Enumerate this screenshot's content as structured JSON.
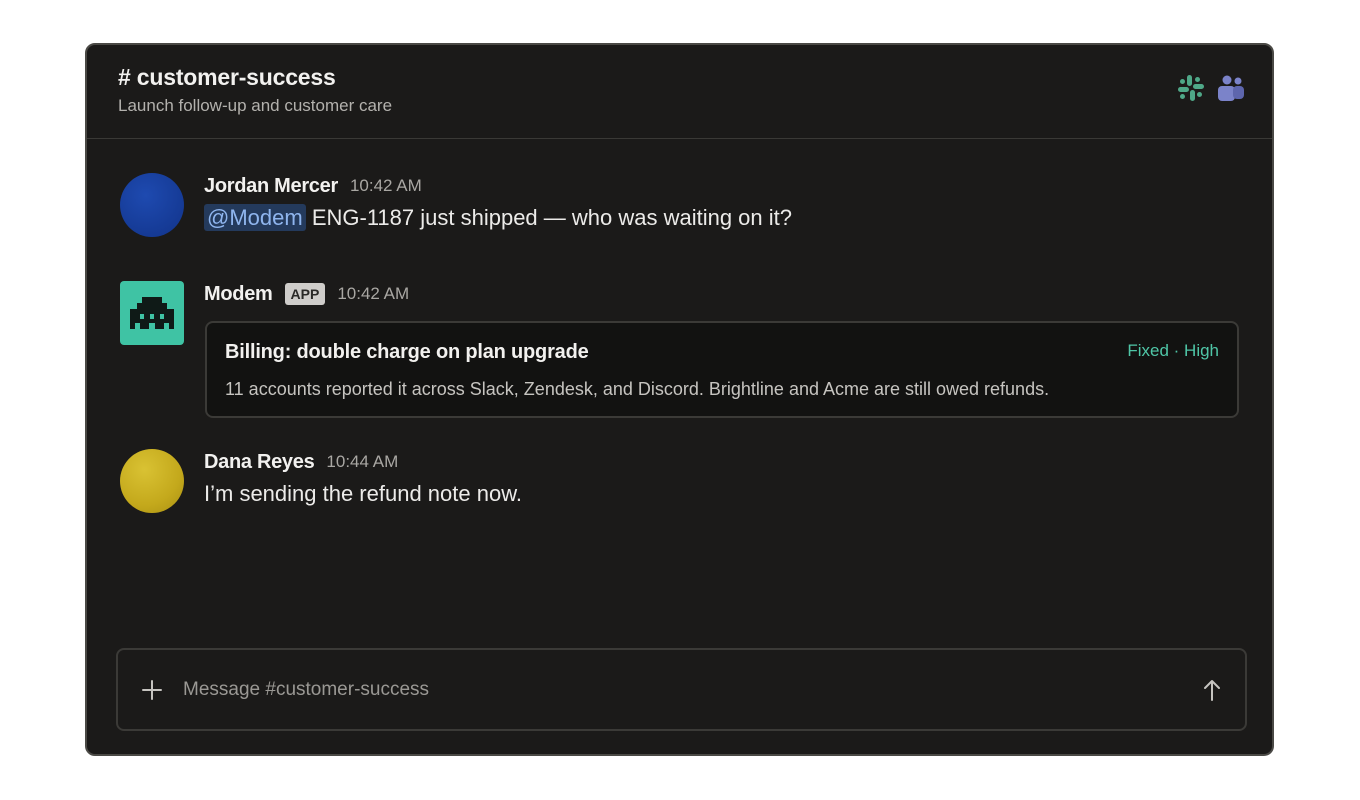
{
  "channel": {
    "title": "# customer-success",
    "description": "Launch follow-up and customer care"
  },
  "header_icons": [
    {
      "name": "slack-icon",
      "color": "#4fa888"
    },
    {
      "name": "teams-icon",
      "color": "#7b83c9"
    }
  ],
  "messages": [
    {
      "author": "Jordan Mercer",
      "time": "10:42 AM",
      "mention": "@Modem",
      "text": "ENG-1187 just shipped — who was waiting on it?"
    },
    {
      "author": "Modem",
      "badge": "APP",
      "time": "10:42 AM",
      "card": {
        "title": "Billing: double charge on plan upgrade",
        "status": "Fixed · High",
        "description": "11 accounts reported it across Slack, Zendesk, and Discord. Brightline and Acme are still owed refunds."
      }
    },
    {
      "author": "Dana Reyes",
      "time": "10:44 AM",
      "text": "I’m sending the refund note now."
    }
  ],
  "composer": {
    "placeholder": "Message #customer-success"
  },
  "colors": {
    "background": "#1b1a19",
    "accent": "#4fc6a7",
    "mention_text": "#8fb5ee",
    "mention_bg": "#243a5c"
  }
}
